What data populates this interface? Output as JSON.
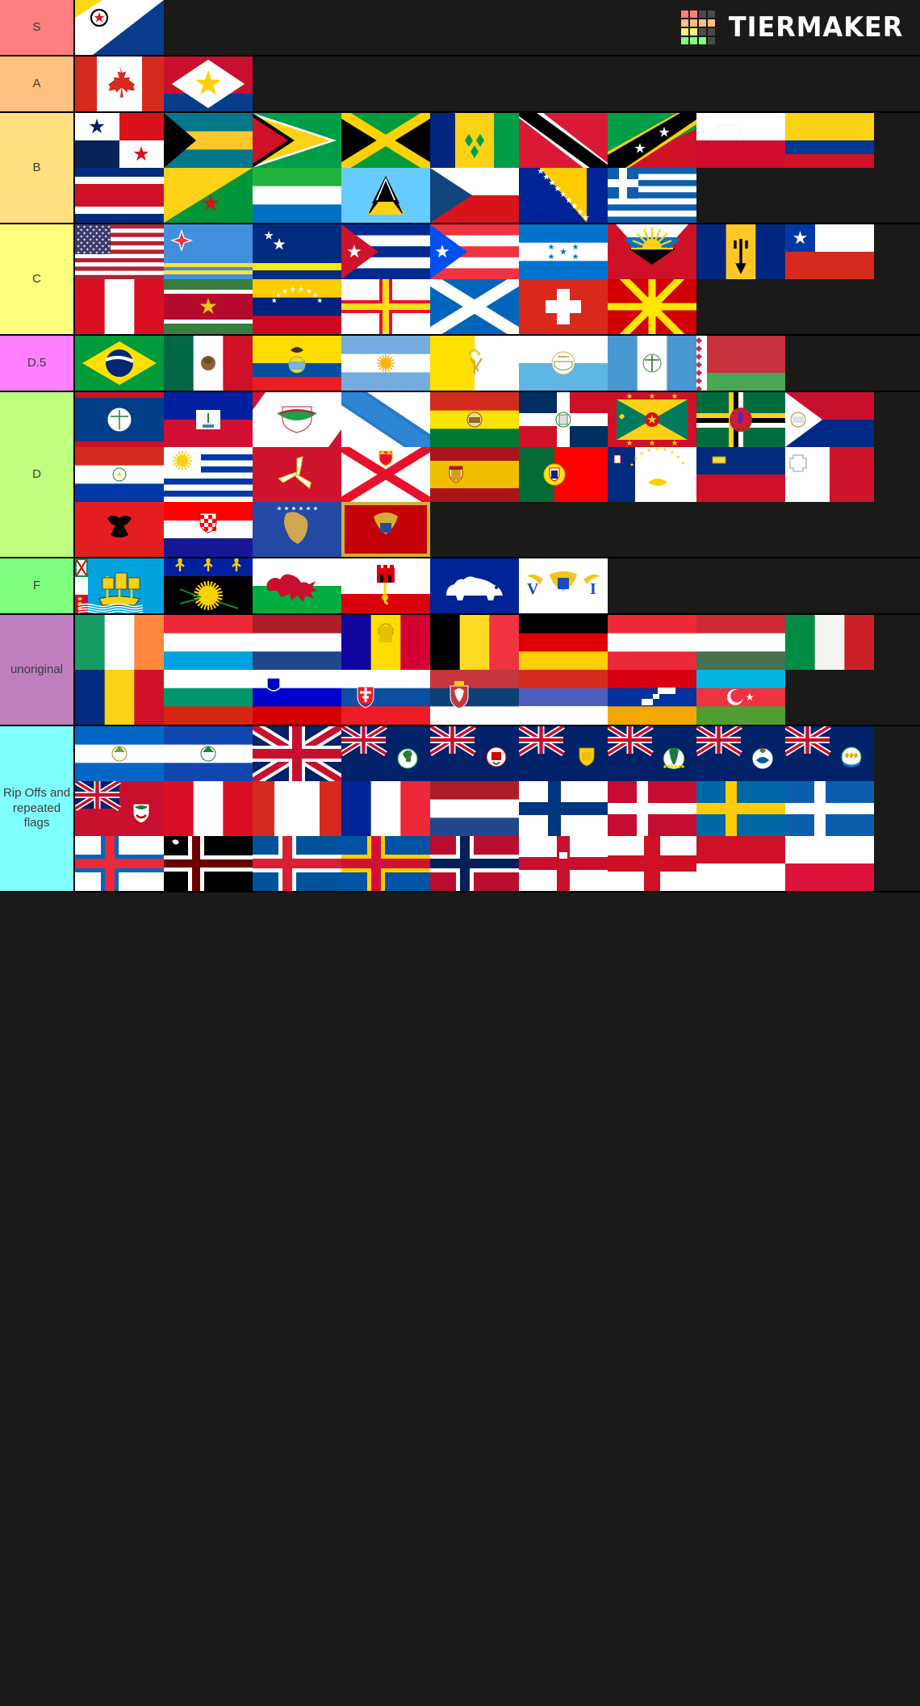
{
  "brand": {
    "name": "TIERMAKER",
    "logo_colors": [
      "#ff7f7f",
      "#ff7f7f",
      "#4a4a48",
      "#4a4a48",
      "#ffbf7f",
      "#ffbf7f",
      "#ffbf7f",
      "#ffbf7f",
      "#ffef7f",
      "#ffef7f",
      "#4a4a48",
      "#4a4a48",
      "#7fff7f",
      "#7fff7f",
      "#7fff7f",
      "#4a4a48"
    ]
  },
  "tiers": [
    {
      "label": "S",
      "color": "#ff7f7f",
      "items": [
        {
          "name": "Bonaire",
          "flag": "bonaire"
        }
      ]
    },
    {
      "label": "A",
      "color": "#ffbf7f",
      "items": [
        {
          "name": "Canada",
          "flag": "canada"
        },
        {
          "name": "Saba",
          "flag": "saba"
        }
      ]
    },
    {
      "label": "B",
      "color": "#ffdf7f",
      "items": [
        {
          "name": "Panama",
          "flag": "panama"
        },
        {
          "name": "Bahamas",
          "flag": "bahamas"
        },
        {
          "name": "Guyana",
          "flag": "guyana"
        },
        {
          "name": "Jamaica",
          "flag": "jamaica"
        },
        {
          "name": "Saint Vincent and the Grenadines",
          "flag": "stvincent"
        },
        {
          "name": "Trinidad and Tobago",
          "flag": "trinidad"
        },
        {
          "name": "Saint Kitts and Nevis",
          "flag": "stkitts"
        },
        {
          "name": "Greenland",
          "flag": "greenland"
        },
        {
          "name": "Colombia",
          "flag": "colombia"
        },
        {
          "name": "Costa Rica",
          "flag": "costarica"
        },
        {
          "name": "French Guiana",
          "flag": "frenchguiana"
        },
        {
          "name": "Sierra Leone",
          "flag": "sierraleone"
        },
        {
          "name": "Saint Lucia",
          "flag": "stlucia"
        },
        {
          "name": "Czech Republic",
          "flag": "czech"
        },
        {
          "name": "Bosnia and Herzegovina",
          "flag": "bosnia"
        },
        {
          "name": "Greece",
          "flag": "greece"
        }
      ]
    },
    {
      "label": "C",
      "color": "#ffff7f",
      "items": [
        {
          "name": "United States",
          "flag": "usa"
        },
        {
          "name": "Aruba",
          "flag": "aruba"
        },
        {
          "name": "Curacao",
          "flag": "curacao"
        },
        {
          "name": "Cuba",
          "flag": "cuba"
        },
        {
          "name": "Puerto Rico",
          "flag": "puertorico"
        },
        {
          "name": "Honduras",
          "flag": "honduras"
        },
        {
          "name": "Antigua and Barbuda",
          "flag": "antigua"
        },
        {
          "name": "Barbados",
          "flag": "barbados"
        },
        {
          "name": "Chile",
          "flag": "chile"
        },
        {
          "name": "Peru",
          "flag": "peru"
        },
        {
          "name": "Suriname",
          "flag": "suriname"
        },
        {
          "name": "Venezuela",
          "flag": "venezuela"
        },
        {
          "name": "Guernsey",
          "flag": "guernsey"
        },
        {
          "name": "Scotland",
          "flag": "scotland"
        },
        {
          "name": "Switzerland",
          "flag": "switzerland"
        },
        {
          "name": "North Macedonia",
          "flag": "macedonia"
        }
      ]
    },
    {
      "label": "D.5",
      "color": "#ff7fff",
      "items": [
        {
          "name": "Brazil",
          "flag": "brazil"
        },
        {
          "name": "Mexico",
          "flag": "mexico"
        },
        {
          "name": "Ecuador",
          "flag": "ecuador"
        },
        {
          "name": "Argentina",
          "flag": "argentina"
        },
        {
          "name": "Vatican City",
          "flag": "vatican"
        },
        {
          "name": "San Marino",
          "flag": "sanmarino"
        },
        {
          "name": "Guatemala",
          "flag": "guatemala"
        },
        {
          "name": "Belarus",
          "flag": "belarus"
        }
      ]
    },
    {
      "label": "D",
      "color": "#bfff7f",
      "items": [
        {
          "name": "Belize",
          "flag": "belize"
        },
        {
          "name": "Haiti",
          "flag": "haiti"
        },
        {
          "name": "Saint Barthelemy",
          "flag": "stbarth"
        },
        {
          "name": "Galicia",
          "flag": "galicia"
        },
        {
          "name": "Bolivia",
          "flag": "bolivia"
        },
        {
          "name": "Dominican Republic",
          "flag": "dominicanrep"
        },
        {
          "name": "Grenada",
          "flag": "grenada"
        },
        {
          "name": "Dominica",
          "flag": "dominica"
        },
        {
          "name": "Sint Maarten",
          "flag": "sintmaarten"
        },
        {
          "name": "Paraguay",
          "flag": "paraguay"
        },
        {
          "name": "Uruguay",
          "flag": "uruguay"
        },
        {
          "name": "Isle of Man",
          "flag": "isleofman"
        },
        {
          "name": "Jersey",
          "flag": "jersey"
        },
        {
          "name": "Spain",
          "flag": "spain"
        },
        {
          "name": "Portugal",
          "flag": "portugal"
        },
        {
          "name": "Azores",
          "flag": "azores"
        },
        {
          "name": "Liechtenstein",
          "flag": "liechtenstein"
        },
        {
          "name": "Malta",
          "flag": "malta"
        },
        {
          "name": "Albania",
          "flag": "albania"
        },
        {
          "name": "Croatia",
          "flag": "croatia"
        },
        {
          "name": "Kosovo",
          "flag": "kosovo"
        },
        {
          "name": "Montenegro",
          "flag": "montenegro"
        }
      ]
    },
    {
      "label": "F",
      "color": "#7fff7f",
      "items": [
        {
          "name": "Saint Pierre and Miquelon",
          "flag": "stpierre"
        },
        {
          "name": "Guadeloupe",
          "flag": "guadeloupe"
        },
        {
          "name": "Wales",
          "flag": "wales"
        },
        {
          "name": "Gibraltar",
          "flag": "gibraltar"
        },
        {
          "name": "Nunavut polar bear flag",
          "flag": "polarbear"
        },
        {
          "name": "United States Virgin Islands",
          "flag": "usvi"
        }
      ]
    },
    {
      "label": "unoriginal",
      "color": "#bf7fbf",
      "items": [
        {
          "name": "Ireland",
          "flag": "ireland"
        },
        {
          "name": "Luxembourg",
          "flag": "luxembourg"
        },
        {
          "name": "Netherlands",
          "flag": "netherlands"
        },
        {
          "name": "Andorra",
          "flag": "andorra"
        },
        {
          "name": "Belgium",
          "flag": "belgium"
        },
        {
          "name": "Germany",
          "flag": "germany"
        },
        {
          "name": "Austria",
          "flag": "austria"
        },
        {
          "name": "Hungary",
          "flag": "hungary"
        },
        {
          "name": "Italy",
          "flag": "italy"
        },
        {
          "name": "Romania",
          "flag": "romania"
        },
        {
          "name": "Bulgaria",
          "flag": "bulgaria"
        },
        {
          "name": "Slovenia",
          "flag": "slovenia"
        },
        {
          "name": "Slovakia",
          "flag": "slovakia"
        },
        {
          "name": "Serbia",
          "flag": "serbia"
        },
        {
          "name": "Russia",
          "flag": "russia"
        },
        {
          "name": "Artsakh",
          "flag": "artsakh"
        },
        {
          "name": "Azerbaijan",
          "flag": "azerbaijan"
        }
      ]
    },
    {
      "label": "Rip Offs and repeated flags",
      "color": "#7fffff",
      "items": [
        {
          "name": "Nicaragua",
          "flag": "nicaragua"
        },
        {
          "name": "El Salvador",
          "flag": "elsalvador"
        },
        {
          "name": "United Kingdom",
          "flag": "uk"
        },
        {
          "name": "Montserrat",
          "flag": "montserrat"
        },
        {
          "name": "Cayman Islands",
          "flag": "cayman"
        },
        {
          "name": "Turks and Caicos Islands",
          "flag": "turkscaicos"
        },
        {
          "name": "British Virgin Islands",
          "flag": "bvi"
        },
        {
          "name": "Falkland Islands",
          "flag": "falkland"
        },
        {
          "name": "Anguilla",
          "flag": "anguilla"
        },
        {
          "name": "Bermuda",
          "flag": "bermuda"
        },
        {
          "name": "Peru (plain)",
          "flag": "peruplain"
        },
        {
          "name": "Canada (plain)",
          "flag": "canadaplain"
        },
        {
          "name": "France",
          "flag": "france"
        },
        {
          "name": "Netherlands (repeat)",
          "flag": "netherlands2"
        },
        {
          "name": "Finland",
          "flag": "finland"
        },
        {
          "name": "Denmark",
          "flag": "denmark"
        },
        {
          "name": "Sweden",
          "flag": "sweden"
        },
        {
          "name": "Greece (repeat)",
          "flag": "greececross"
        },
        {
          "name": "Faroe Islands",
          "flag": "faroe"
        },
        {
          "name": "Sapmi",
          "flag": "sapmi"
        },
        {
          "name": "Iceland",
          "flag": "iceland"
        },
        {
          "name": "Aland Islands",
          "flag": "aland"
        },
        {
          "name": "Norway",
          "flag": "norway"
        },
        {
          "name": "Ulster",
          "flag": "ulster"
        },
        {
          "name": "England",
          "flag": "england"
        },
        {
          "name": "Indonesia",
          "flag": "indonesia"
        },
        {
          "name": "Poland",
          "flag": "poland"
        }
      ]
    }
  ]
}
